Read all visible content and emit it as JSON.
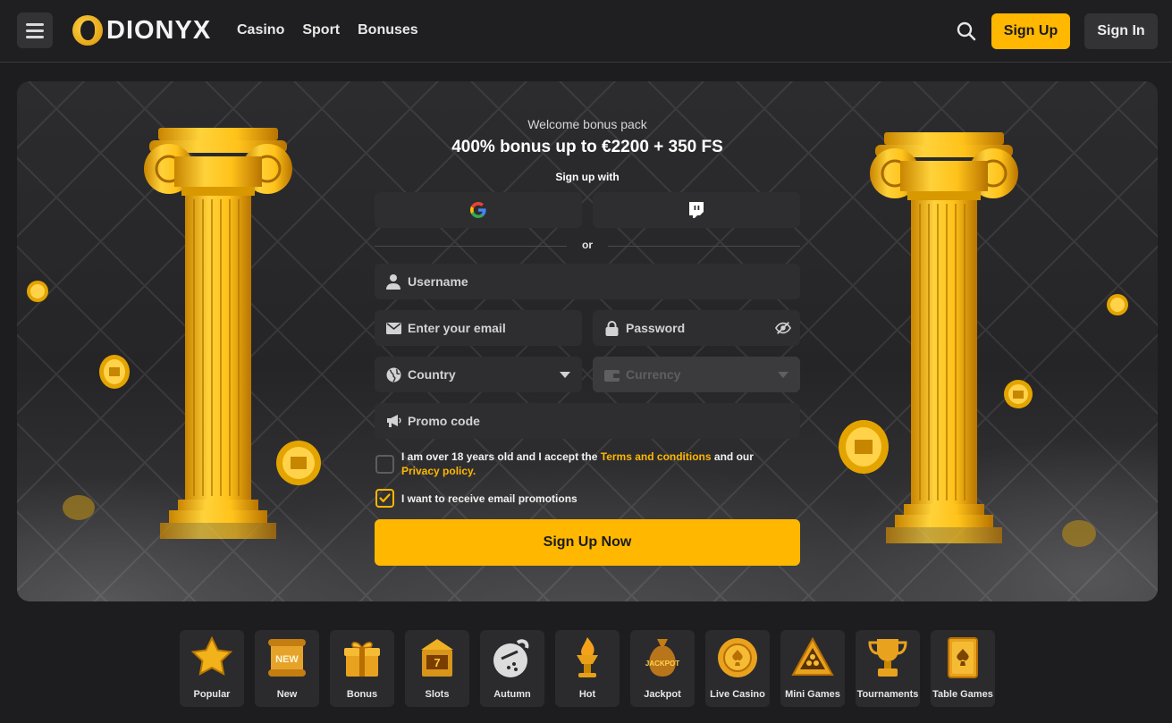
{
  "header": {
    "logo_text": "DIONYX",
    "nav": [
      "Casino",
      "Sport",
      "Bonuses"
    ],
    "signup_label": "Sign Up",
    "signin_label": "Sign In"
  },
  "colors": {
    "accent": "#ffb700",
    "background": "#1d1d1f",
    "field": "#2e2e31"
  },
  "hero": {
    "welcome": "Welcome bonus pack",
    "headline": "400% bonus up to €2200 + 350 FS",
    "signup_with": "Sign up with",
    "or": "or"
  },
  "form": {
    "username_placeholder": "Username",
    "email_placeholder": "Enter your email",
    "password_placeholder": "Password",
    "country_placeholder": "Country",
    "currency_placeholder": "Currency",
    "promo_placeholder": "Promo code",
    "age_text_1": "I am over 18 years old and I accept the ",
    "terms_link": "Terms and conditions",
    "age_text_2": " and our",
    "privacy_link": "Privacy policy.",
    "age_checked": false,
    "promotions_text": "I want to receive email promotions",
    "promotions_checked": true,
    "submit_label": "Sign Up Now"
  },
  "icons": {
    "google": "google-icon",
    "twitch": "twitch-icon",
    "user": "user-icon",
    "mail": "mail-icon",
    "lock": "lock-icon",
    "eye": "eye-off-icon",
    "globe": "globe-icon",
    "wallet": "wallet-icon",
    "megaphone": "megaphone-icon",
    "search": "search-icon",
    "menu": "hamburger-icon"
  },
  "categories": [
    {
      "label": "Popular"
    },
    {
      "label": "New"
    },
    {
      "label": "Bonus"
    },
    {
      "label": "Slots"
    },
    {
      "label": "Autumn"
    },
    {
      "label": "Hot"
    },
    {
      "label": "Jackpot"
    },
    {
      "label": "Live Casino"
    },
    {
      "label": "Mini Games"
    },
    {
      "label": "Tournaments"
    },
    {
      "label": "Table Games"
    }
  ]
}
